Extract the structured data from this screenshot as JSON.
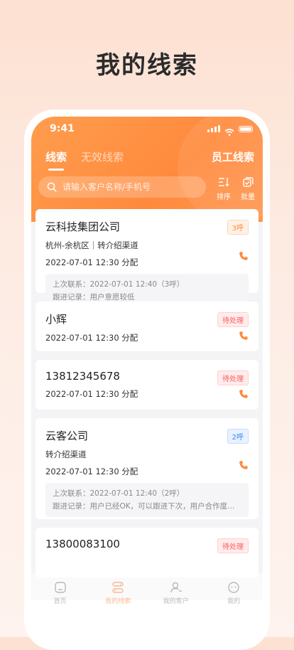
{
  "promo": {
    "title": "我的线索"
  },
  "status_bar": {
    "time": "9:41"
  },
  "header": {
    "tabs": [
      {
        "label": "线索",
        "active": true
      },
      {
        "label": "无效线索",
        "active": false
      }
    ],
    "staff_link": "员工线索",
    "search": {
      "placeholder": "请输入客户名称/手机号"
    },
    "tools": {
      "sort_label": "排序",
      "batch_label": "批量"
    }
  },
  "colors": {
    "accent": "#ff8a3d",
    "blue": "#3d86ff",
    "red": "#ff5a5a"
  },
  "cards": [
    {
      "title": "云科技集团公司",
      "badge": "3呼",
      "badge_style": "orange",
      "location": "杭州-余杭区｜转介绍渠道",
      "assigned": "2022-07-01 12:30 分配",
      "last_contact": "上次联系：2022-07-01 12:40（3呼）",
      "follow_up": "跟进记录：用户意愿较低"
    },
    {
      "title": "小辉",
      "badge": "待处理",
      "badge_style": "red",
      "assigned": "2022-07-01 12:30 分配"
    },
    {
      "title": "13812345678",
      "badge": "待处理",
      "badge_style": "red",
      "assigned": "2022-07-01 12:30 分配"
    },
    {
      "title": "云客公司",
      "badge": "2呼",
      "badge_style": "blue",
      "channel": "转介绍渠道",
      "assigned": "2022-07-01 12:30 分配",
      "last_contact": "上次联系：2022-07-01 12:40（2呼）",
      "follow_up": "跟进记录：用户已经OK，可以跟进下次，用户合作度..."
    },
    {
      "title": "13800083100",
      "badge": "待处理",
      "badge_style": "red"
    }
  ],
  "bottom_nav": [
    {
      "label": "首页",
      "icon": "home-icon",
      "active": false
    },
    {
      "label": "我的线索",
      "icon": "leads-icon",
      "active": true
    },
    {
      "label": "我的客户",
      "icon": "customer-icon",
      "active": false
    },
    {
      "label": "我的",
      "icon": "profile-icon",
      "active": false
    }
  ]
}
